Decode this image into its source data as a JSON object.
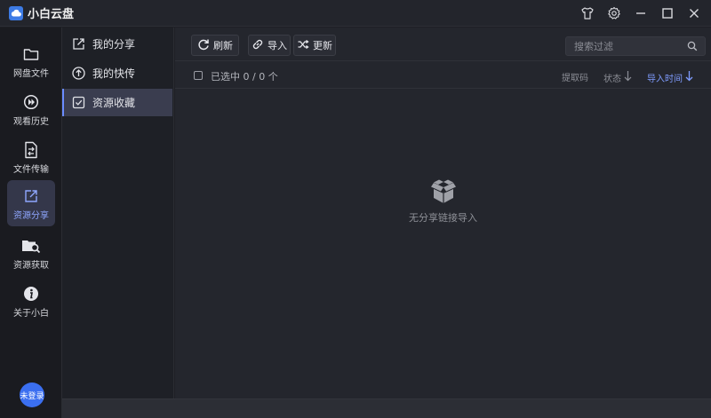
{
  "app": {
    "title": "小白云盘",
    "logo_icon": "cloud-icon"
  },
  "window_controls": [
    {
      "name": "skin-icon"
    },
    {
      "name": "settings-gear-icon"
    },
    {
      "name": "minimize-icon"
    },
    {
      "name": "maximize-icon"
    },
    {
      "name": "close-icon"
    }
  ],
  "rail": {
    "items": [
      {
        "label": "网盘文件",
        "icon": "folder-icon"
      },
      {
        "label": "观看历史",
        "icon": "play-history-icon"
      },
      {
        "label": "文件传输",
        "icon": "file-transfer-icon"
      },
      {
        "label": "资源分享",
        "icon": "share-icon",
        "active": true
      },
      {
        "label": "资源获取",
        "icon": "folder-search-icon"
      },
      {
        "label": "关于小白",
        "icon": "info-icon"
      }
    ],
    "user": {
      "label": "未登录"
    }
  },
  "subnav": {
    "items": [
      {
        "label": "我的分享",
        "icon": "share-box-icon"
      },
      {
        "label": "我的快传",
        "icon": "upload-circle-icon"
      },
      {
        "label": "资源收藏",
        "icon": "collect-icon",
        "active": true
      }
    ]
  },
  "toolbar": {
    "refresh_label": "刷新",
    "import_label": "导入",
    "update_label": "更新",
    "search_placeholder": "搜索过滤"
  },
  "list": {
    "selection_text": "已选中 0 / 0 个",
    "columns": {
      "code": "提取码",
      "status": "状态",
      "import_time": "导入时间"
    },
    "empty_text": "无分享链接导入",
    "empty_icon": "empty-box-icon"
  },
  "colors": {
    "accent": "#6b8cff",
    "avatar": "#3b6ff0",
    "logo": "#3d7be5"
  }
}
